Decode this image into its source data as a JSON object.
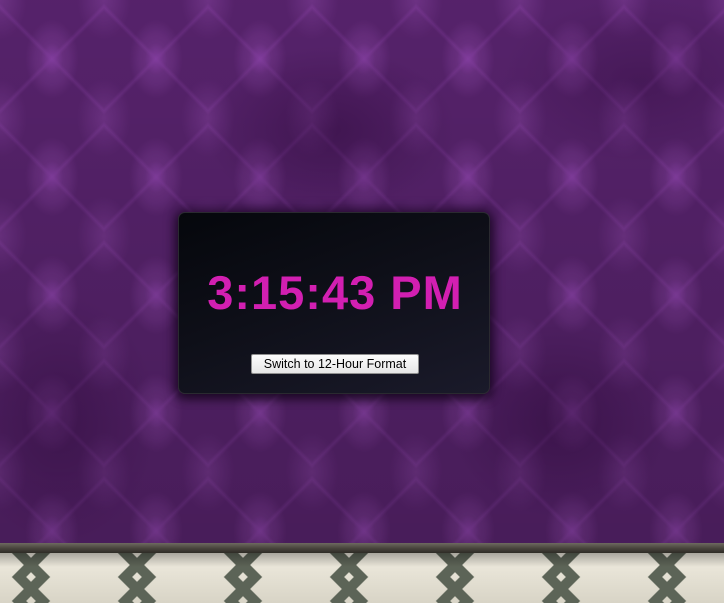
{
  "clock": {
    "time": "3:15:43 PM",
    "format_button_label": "Switch to 12-Hour Format"
  },
  "colors": {
    "time_text": "#d21fb1",
    "panel_background": "#0e0f18",
    "wallpaper": "#5a2470",
    "floor_tile": "#e8e4d6",
    "floor_inlay": "#5c6457"
  }
}
